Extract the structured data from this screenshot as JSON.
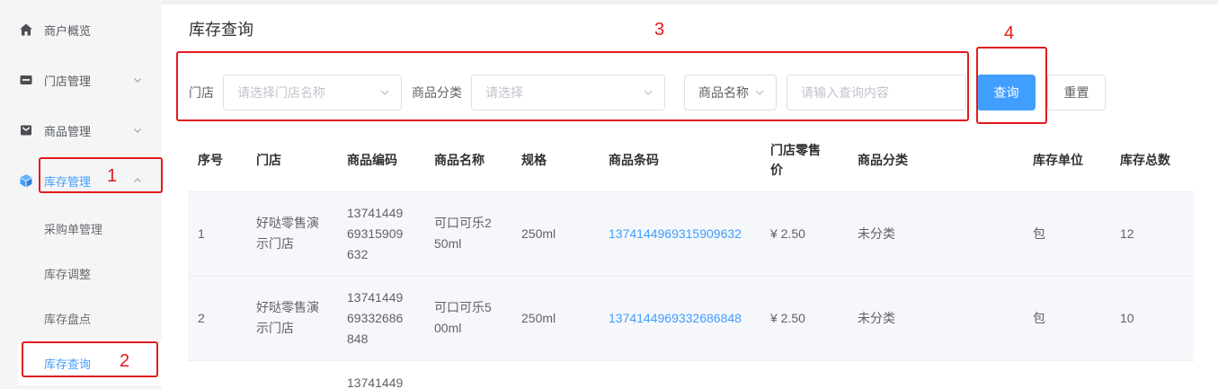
{
  "sidebar": {
    "items": [
      {
        "label": "商户概览",
        "icon": "home-icon"
      },
      {
        "label": "门店管理",
        "icon": "store-icon",
        "chevron": "chevron-down-icon"
      },
      {
        "label": "商品管理",
        "icon": "goods-icon",
        "chevron": "chevron-down-icon"
      },
      {
        "label": "库存管理",
        "icon": "inventory-cube-icon",
        "chevron": "chevron-up-icon",
        "active": true
      }
    ],
    "submenu": [
      {
        "label": "采购单管理"
      },
      {
        "label": "库存调整"
      },
      {
        "label": "库存盘点"
      },
      {
        "label": "库存查询",
        "active": true
      }
    ]
  },
  "page": {
    "title": "库存查询"
  },
  "filters": {
    "store_label": "门店",
    "store_placeholder": "请选择门店名称",
    "category_label": "商品分类",
    "category_placeholder": "请选择",
    "field_select_value": "商品名称",
    "keyword_placeholder": "请输入查询内容",
    "search_button": "查询",
    "reset_button": "重置"
  },
  "table": {
    "columns": [
      "序号",
      "门店",
      "商品编码",
      "商品名称",
      "规格",
      "商品条码",
      "门店零售价",
      "商品分类",
      "库存单位",
      "库存总数"
    ],
    "rows": [
      {
        "index": "1",
        "store": "好哒零售演示门店",
        "code": "1374144969315909632",
        "name": "可口可乐250ml",
        "spec": "250ml",
        "barcode": "1374144969315909632",
        "price": "¥ 2.50",
        "category": "未分类",
        "unit": "包",
        "stock": "12"
      },
      {
        "index": "2",
        "store": "好哒零售演示门店",
        "code": "1374144969332686848",
        "name": "可口可乐500ml",
        "spec": "250ml",
        "barcode": "1374144969332686848",
        "price": "¥ 2.50",
        "category": "未分类",
        "unit": "包",
        "stock": "10"
      },
      {
        "code": "13741449"
      }
    ]
  },
  "annotations": [
    {
      "label": "1"
    },
    {
      "label": "2"
    },
    {
      "label": "3"
    },
    {
      "label": "4"
    }
  ],
  "colors": {
    "accent": "#409eff",
    "annotation": "#e3191c",
    "sidebar_bg": "#f5f5f5",
    "row_bg": "#f5f7fa"
  }
}
